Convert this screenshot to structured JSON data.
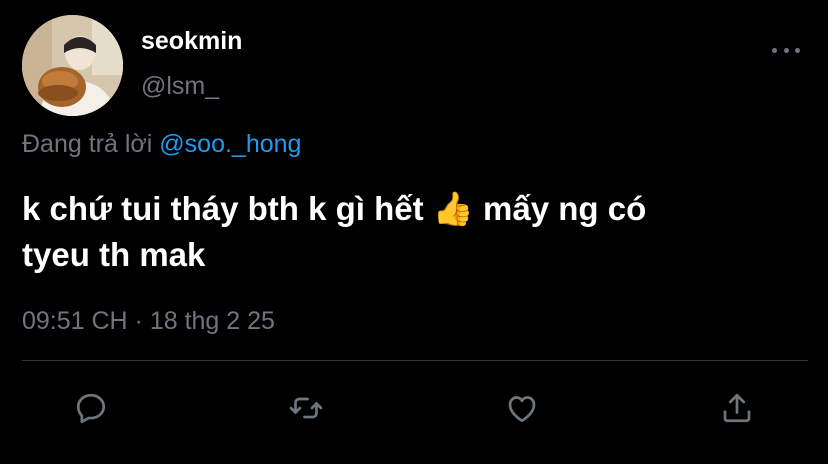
{
  "author": {
    "display_name": "seokmin",
    "handle": "@lsm_"
  },
  "reply_context": {
    "prefix": "Đang trả lời",
    "mention": "@soo._hong"
  },
  "tweet": {
    "text_line1": "k chứ tui tháy bth k gì hết",
    "emoji": "👍",
    "text_line1_end": "mấy ng có",
    "text_line2": "tyeu th mak"
  },
  "meta": {
    "timestamp": "09:51 CH · 18 thg 2 25"
  },
  "actions": [
    {
      "icon": "reply-icon"
    },
    {
      "icon": "retweet-icon"
    },
    {
      "icon": "like-icon"
    },
    {
      "icon": "share-icon"
    }
  ],
  "colors": {
    "background": "#000000",
    "primary_text": "#ffffff",
    "secondary_text": "#6e767d",
    "link": "#1d9bf0",
    "divider": "#2f3336"
  }
}
